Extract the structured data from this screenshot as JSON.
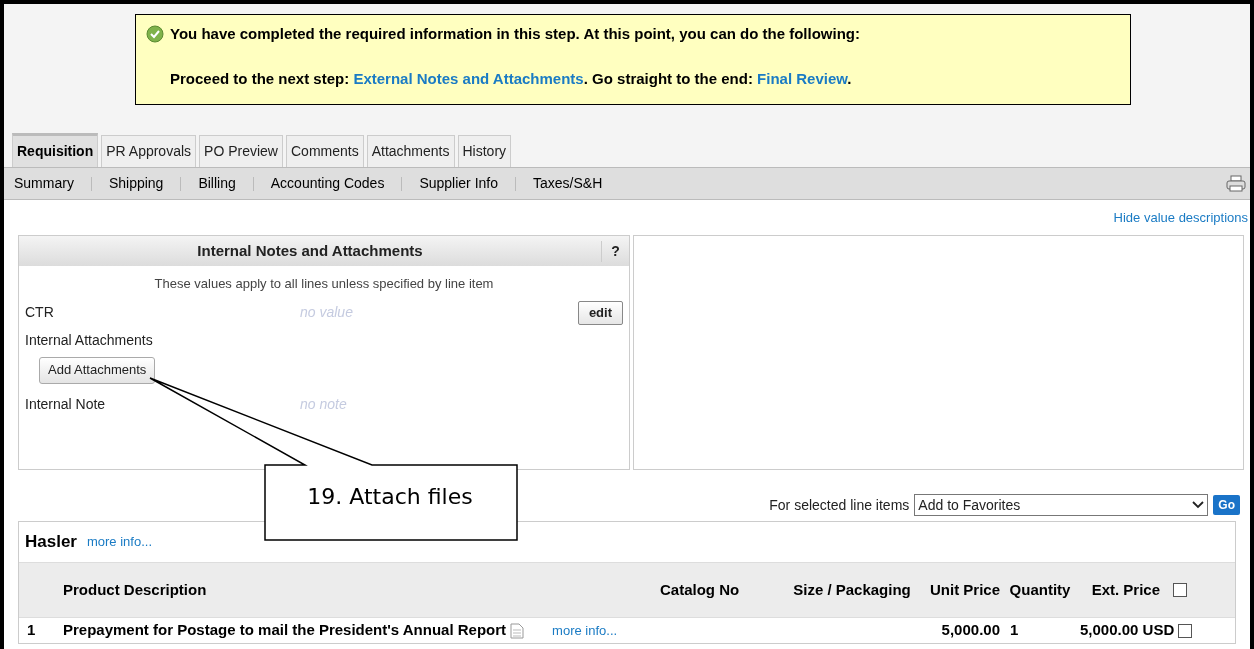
{
  "banner": {
    "message": "You have completed the required information in this step. At this point, you can do the following:",
    "parts": [
      {
        "kind": "text",
        "text": "Proceed to the next step: "
      },
      {
        "kind": "link",
        "text": "External Notes and Attachments"
      },
      {
        "kind": "text",
        "text": ". Go straight to the end: "
      },
      {
        "kind": "link",
        "text": "Final Review"
      },
      {
        "kind": "text",
        "text": "."
      }
    ]
  },
  "tabs": [
    {
      "label": "Requisition",
      "selected": true
    },
    {
      "label": "PR Approvals",
      "selected": false
    },
    {
      "label": "PO Preview",
      "selected": false
    },
    {
      "label": "Comments",
      "selected": false
    },
    {
      "label": "Attachments",
      "selected": false
    },
    {
      "label": "History",
      "selected": false
    }
  ],
  "subnav": [
    "Summary",
    "Shipping",
    "Billing",
    "Accounting Codes",
    "Supplier Info",
    "Taxes/S&H"
  ],
  "hide_link": "Hide value descriptions",
  "panel": {
    "title": "Internal Notes and Attachments",
    "help": "?",
    "note": "These values apply to all lines unless specified by line item",
    "ctr": {
      "label": "CTR",
      "value": "no value",
      "button": "edit"
    },
    "attachments": {
      "label": "Internal Attachments",
      "button": "Add Attachments"
    },
    "internal_note": {
      "label": "Internal Note",
      "value": "no note"
    }
  },
  "callout": "19. Attach files",
  "line_action": {
    "label": "For selected line items",
    "value": "Add to Favorites",
    "button": "Go"
  },
  "supplier": {
    "name": "Hasler",
    "link": "more info..."
  },
  "table": {
    "columns": [
      "Product Description",
      "Catalog No",
      "Size / Packaging",
      "Unit Price",
      "Quantity",
      "Ext. Price"
    ],
    "header_checked": false,
    "rows": [
      {
        "number": "1",
        "description": "Prepayment for Postage to mail the President's Annual Report",
        "link": "more info...",
        "catalog": "",
        "size": "",
        "unit_price": "5,000.00",
        "quantity": "1",
        "ext_price": "5,000.00 USD",
        "checked": false
      }
    ]
  }
}
